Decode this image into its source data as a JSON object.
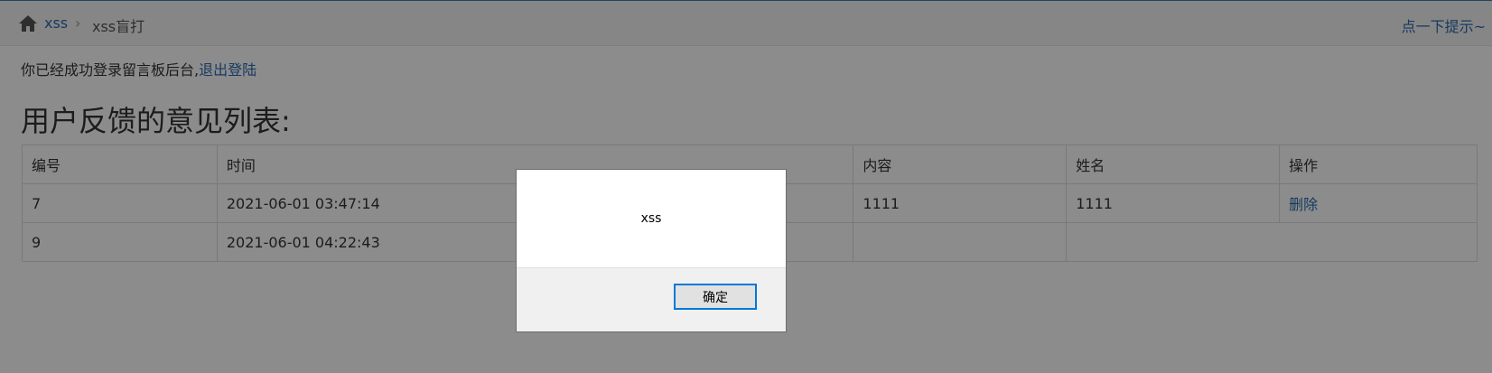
{
  "breadcrumb": {
    "home_icon": "home-icon",
    "link": "xss",
    "separator": "›",
    "current": "xss盲打"
  },
  "hint": "点一下提示~",
  "login": {
    "text": "你已经成功登录留言板后台,",
    "logout_link": "退出登陆"
  },
  "title": "用户反馈的意见列表:",
  "table": {
    "headers": [
      "编号",
      "时间",
      "内容",
      "姓名",
      "操作"
    ],
    "rows": [
      {
        "id": "7",
        "time": "2021-06-01 03:47:14",
        "content": "1111",
        "name": "1111",
        "op": "删除"
      },
      {
        "id": "9",
        "time": "2021-06-01 04:22:43",
        "content": "",
        "name": "",
        "op": ""
      }
    ]
  },
  "dialog": {
    "message": "xss",
    "ok_label": "确定"
  },
  "colors": {
    "link": "#2a6ab0",
    "overlay": "rgba(0,0,0,0.45)",
    "dialog_button_border": "#0078d7"
  }
}
